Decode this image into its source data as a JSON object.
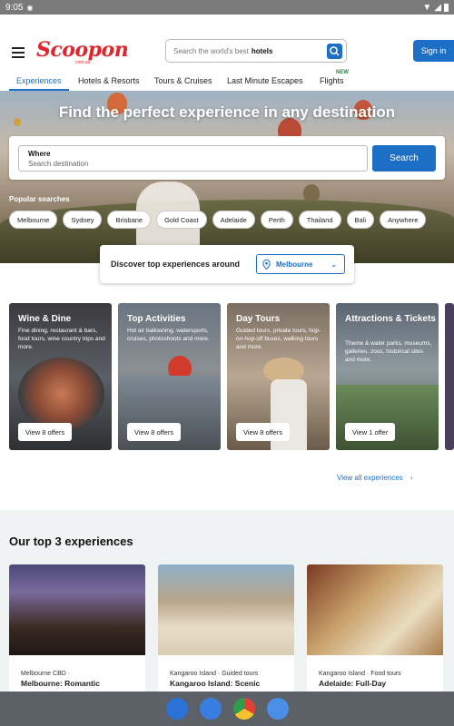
{
  "status": {
    "time": "9:05"
  },
  "header": {
    "logo": "Scoopon",
    "logo_sub": "com.au",
    "search_prefix": "Search the world's best",
    "search_bold": "hotels",
    "signin": "Sign in"
  },
  "nav": {
    "tabs": [
      "Experiences",
      "Hotels & Resorts",
      "Tours & Cruises",
      "Last Minute Escapes",
      "Flights"
    ],
    "new_badge": "NEW"
  },
  "hero": {
    "title": "Find the perfect experience in any destination",
    "where_label": "Where",
    "where_placeholder": "Search destination",
    "search_button": "Search",
    "popular_label": "Popular searches",
    "chips": [
      "Melbourne",
      "Sydney",
      "Brisbane",
      "Gold Coast",
      "Adelaide",
      "Perth",
      "Thailand",
      "Bali",
      "Anywhere"
    ]
  },
  "discover": {
    "text": "Discover top experiences around",
    "location": "Melbourne"
  },
  "cards": [
    {
      "title": "Wine & Dine",
      "desc": "Fine dining, restaurant & bars, food tours, wine country trips and more.",
      "button": "View 8 offers"
    },
    {
      "title": "Top Activities",
      "desc": "Hot air ballooning, watersports, cruises, photoshoots and more.",
      "button": "View 8 offers"
    },
    {
      "title": "Day Tours",
      "desc": "Guided tours, private tours, hop-on-hop-off buses, walking tours and more.",
      "button": "View 8 offers"
    },
    {
      "title": "Attractions & Tickets",
      "desc": "Theme & water parks, museums, galleries, zoos, historical sites and more.",
      "button": "View 1 offer"
    }
  ],
  "view_all": "View all experiences",
  "top3": {
    "heading": "Our top 3 experiences",
    "items": [
      {
        "location": "Melbourne CBD ·",
        "name": "Melbourne: Romantic"
      },
      {
        "location": "Kangaroo Island · Guided tours",
        "name": "Kangaroo Island: Scenic"
      },
      {
        "location": "Kangaroo Island · Food tours",
        "name": "Adelaide: Full-Day"
      }
    ]
  },
  "colors": {
    "brand": "#e0262d",
    "accent": "#1d6fc6"
  }
}
